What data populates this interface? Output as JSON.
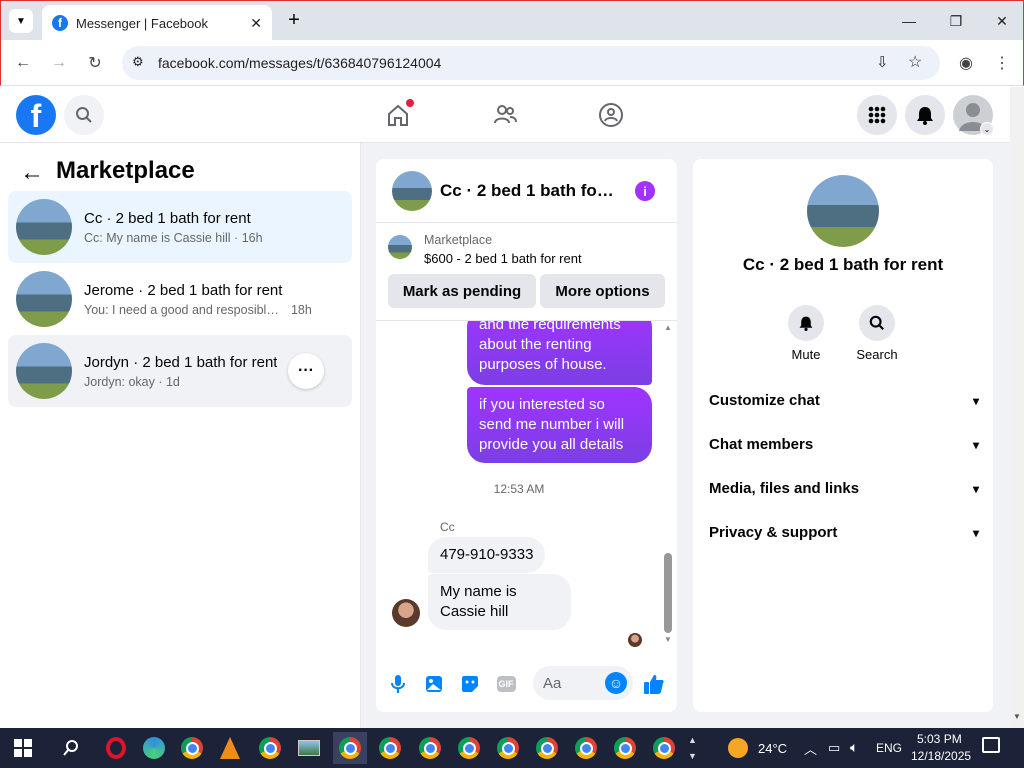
{
  "browser": {
    "tab_title": "Messenger | Facebook",
    "url": "facebook.com/messages/t/636840796124004"
  },
  "left": {
    "title": "Marketplace",
    "conversations": [
      {
        "name": "Cc · 2 bed 1 bath for rent",
        "snippet": "Cc: My name is Cassie hill",
        "time": "16h"
      },
      {
        "name": "Jerome · 2 bed 1 bath for rent",
        "snippet": "You: I need a good and resposible te...",
        "time": "18h"
      },
      {
        "name": "Jordyn · 2 bed 1 bath for rent",
        "snippet": "Jordyn: okay",
        "time": "1d"
      }
    ]
  },
  "chat": {
    "title": "Cc · 2 bed 1 bath for ...",
    "marketplace_label": "Marketplace",
    "listing": "$600 - 2 bed 1 bath for rent",
    "mark_pending": "Mark as pending",
    "more_options": "More options",
    "messages": [
      "and the requirements about the renting purposes of house.",
      "if you interested so send me number i will provide you all details"
    ],
    "time_divider": "12:53 AM",
    "sender": "Cc",
    "received": [
      "479-910-9333",
      "My name is Cassie hill"
    ],
    "composer_placeholder": "Aa"
  },
  "right": {
    "name": "Cc · 2 bed 1 bath for rent",
    "mute": "Mute",
    "search": "Search",
    "sections": [
      "Customize chat",
      "Chat members",
      "Media, files and links",
      "Privacy & support"
    ]
  },
  "taskbar": {
    "temp": "24°C",
    "lang": "ENG",
    "time": "5:03 PM",
    "date": "12/18/2025"
  },
  "colors": {
    "fb_blue": "#1877f2",
    "messenger_purple": "#a033ff"
  }
}
